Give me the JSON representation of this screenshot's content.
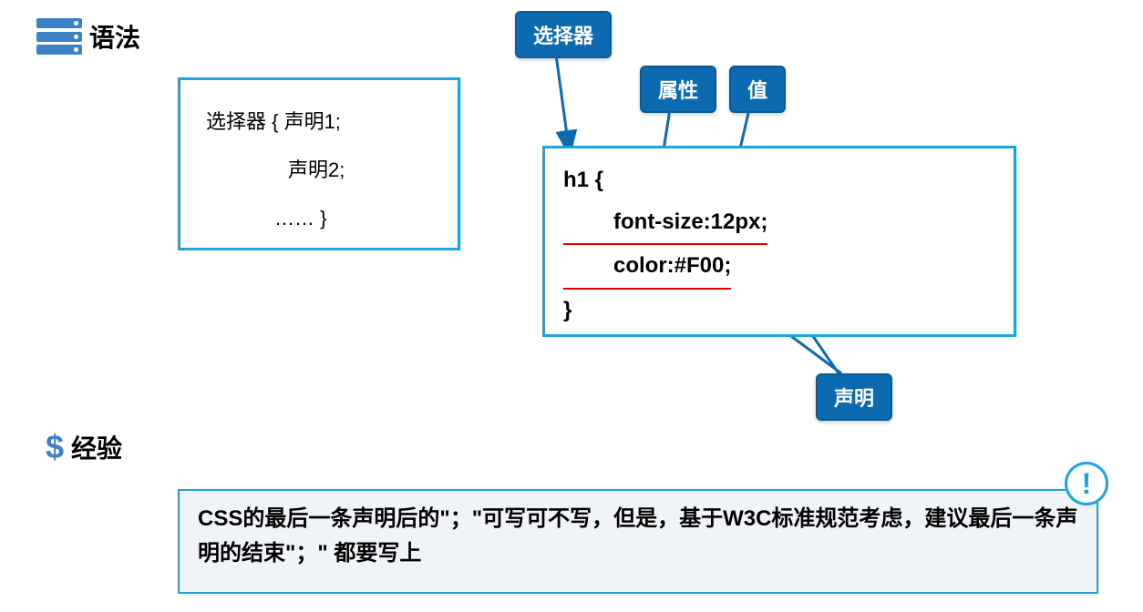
{
  "syntax": {
    "title": "语法",
    "line1": "选择器 { 声明1;",
    "line2": "声明2;",
    "line3": "……   }"
  },
  "labels": {
    "selector": "选择器",
    "attribute": "属性",
    "value": "值",
    "declaration": "声明"
  },
  "example": {
    "line1": "h1 {",
    "line2": "font-size:12px;",
    "line3": "color:#F00;",
    "line4": "}"
  },
  "experience": {
    "title": "经验",
    "text": "CSS的最后一条声明后的\"；\"可写可不写，但是，基于W3C标准规范考虑，建议最后一条声明的结束\"；\" 都要写上"
  },
  "info_symbol": "!"
}
